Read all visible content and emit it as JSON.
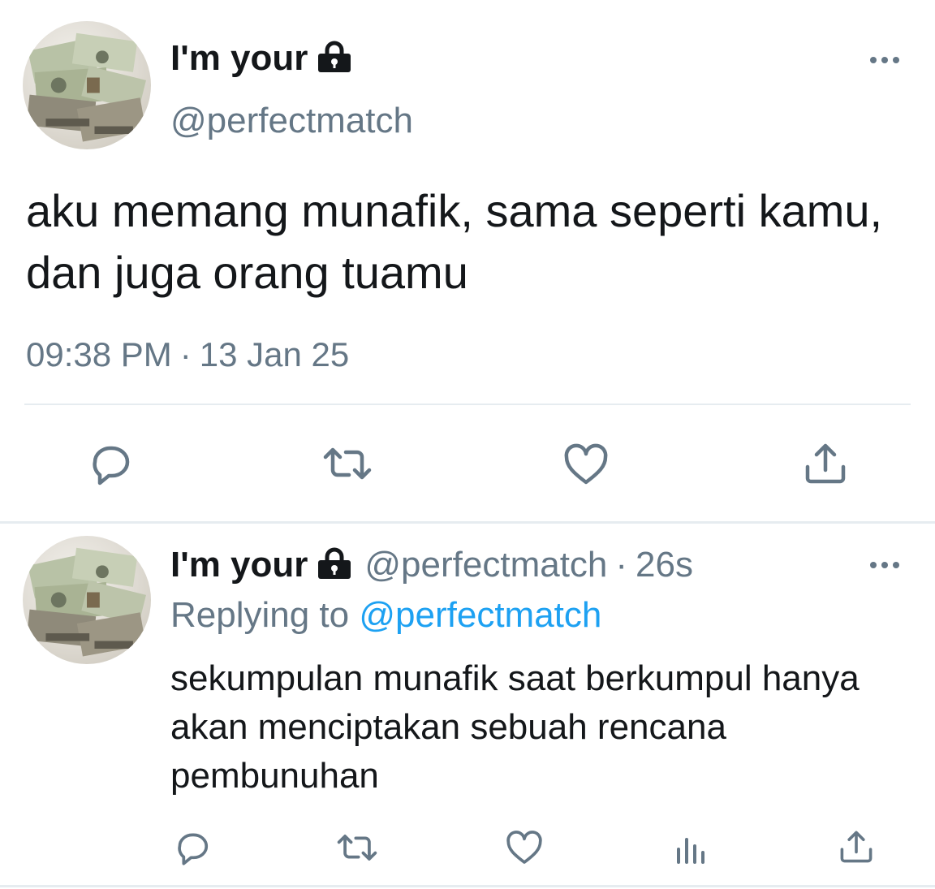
{
  "tweet": {
    "author_name": "I'm your",
    "author_handle": "@perfectmatch",
    "text": "aku memang munafik, sama seperti kamu, dan juga orang tuamu",
    "time": "09:38 PM",
    "separator": "·",
    "date": "13 Jan 25",
    "actions": [
      "reply-icon",
      "retweet-icon",
      "like-icon",
      "share-icon"
    ]
  },
  "reply": {
    "author_name": "I'm your",
    "author_handle": "@perfectmatch",
    "meta_separator": "·",
    "age": "26s",
    "replying_prefix": "Replying to",
    "replying_handle": "@perfectmatch",
    "text": "sekumpulan munafik saat berkumpul hanya akan menciptakan sebuah rencana pembunuhan",
    "actions": [
      "reply-icon",
      "retweet-icon",
      "like-icon",
      "analytics-icon",
      "share-icon"
    ]
  },
  "colors": {
    "text": "#14171a",
    "secondary": "#657786",
    "link": "#1da1f2",
    "divider": "#e6ecf0"
  }
}
